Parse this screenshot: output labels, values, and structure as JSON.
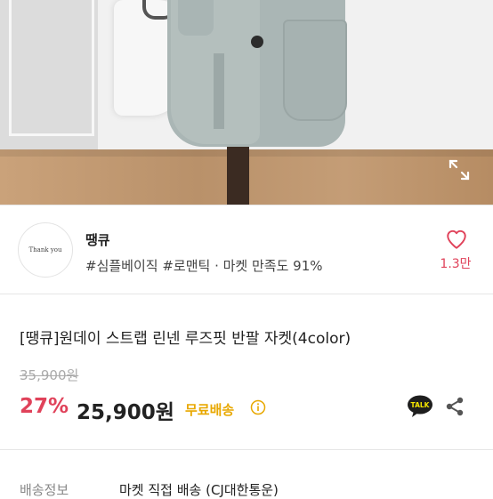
{
  "seller": {
    "name": "땡큐",
    "logo_text": "Thank you",
    "tags": "#심플베이직 #로맨틱 · 마켓 만족도 91%",
    "favorite_count": "1.3만"
  },
  "product": {
    "title": "[땡큐]원데이 스트랩 린넨 루즈핏 반팔 자켓(4color)",
    "original_price": "35,900원",
    "discount": "27%",
    "price": "25,900원",
    "free_shipping": "무료배송"
  },
  "shipping": {
    "label": "배송정보",
    "value": "마켓 직접 배송 (CJ대한통운)"
  },
  "colors": {
    "accent": "#e0425a",
    "free_shipping": "#e8a800"
  },
  "icons": [
    "expand-icon",
    "heart-icon",
    "info-icon",
    "kakaotalk-icon",
    "share-icon"
  ]
}
